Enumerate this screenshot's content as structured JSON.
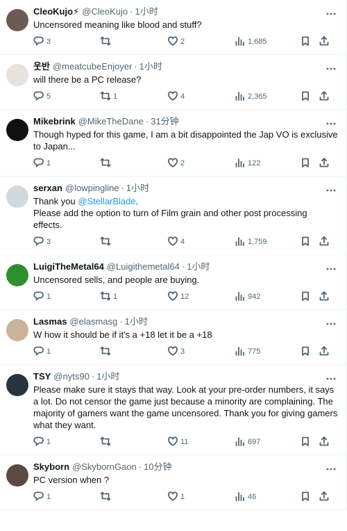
{
  "tweets": [
    {
      "name": "CleoKujo⚡",
      "handle": "@CleoKujo",
      "time": "1小时",
      "lines": [
        "Uncensored meaning like blood and stuff?"
      ],
      "replies": "3",
      "retweets": "",
      "likes": "2",
      "views": "1,685",
      "avatar_color": "#6b5b53"
    },
    {
      "name": "웃반",
      "handle": "@meatcubeEnjoyer",
      "time": "1小时",
      "lines": [
        "will there be a PC release?"
      ],
      "replies": "5",
      "retweets": "1",
      "likes": "4",
      "views": "2,365",
      "avatar_color": "#e6e2dd"
    },
    {
      "name": "Mikebrink",
      "handle": "@MikeTheDane",
      "time": "31分钟",
      "lines": [
        "Though hyped for this game, I am a bit disappointed the Jap VO is exclusive",
        "to Japan..."
      ],
      "replies": "1",
      "retweets": "",
      "likes": "2",
      "views": "122",
      "avatar_color": "#111111"
    },
    {
      "name": "serxan",
      "handle": "@lowpingline",
      "time": "1小时",
      "body_prefix": "Thank you ",
      "mention": "@StellarBlade",
      "body_suffix": ".",
      "lines": [
        "Please add the option to turn of Film grain and other post processing",
        "effects."
      ],
      "replies": "3",
      "retweets": "",
      "likes": "4",
      "views": "1,759",
      "avatar_color": "#cfd9de"
    },
    {
      "name": "LuigiTheMetal64",
      "handle": "@Luigithemetal64",
      "time": "1小时",
      "lines": [
        "Uncensored sells, and people are buying."
      ],
      "replies": "1",
      "retweets": "1",
      "likes": "12",
      "views": "942",
      "avatar_color": "#2f8f2f"
    },
    {
      "name": "Lasmas",
      "handle": "@elasmasg",
      "time": "1小时",
      "lines": [
        "W how it should be if it's a +18 let it be a +18"
      ],
      "replies": "1",
      "retweets": "",
      "likes": "3",
      "views": "775",
      "avatar_color": "#c9b49a"
    },
    {
      "name": "TSY",
      "handle": "@nyts90",
      "time": "1小时",
      "lines": [
        "Please make sure it stays that way. Look at your pre-order numbers, it says",
        "a lot. Do not censor the game just because a minority are complaining. The",
        "majority of gamers want the game uncensored. Thank you for giving gamers",
        "what they want."
      ],
      "replies": "1",
      "retweets": "",
      "likes": "11",
      "views": "697",
      "avatar_color": "#2a3340"
    },
    {
      "name": "Skyborn",
      "handle": "@SkybornGaon",
      "time": "10分钟",
      "lines": [
        "PC version when ?"
      ],
      "replies": "1",
      "retweets": "",
      "likes": "1",
      "views": "46",
      "avatar_color": "#5a4a42"
    }
  ],
  "icons": {
    "reply": "reply-icon",
    "retweet": "retweet-icon",
    "like": "like-icon",
    "views": "views-icon",
    "bookmark": "bookmark-icon",
    "share": "share-icon",
    "more": "more-icon"
  }
}
